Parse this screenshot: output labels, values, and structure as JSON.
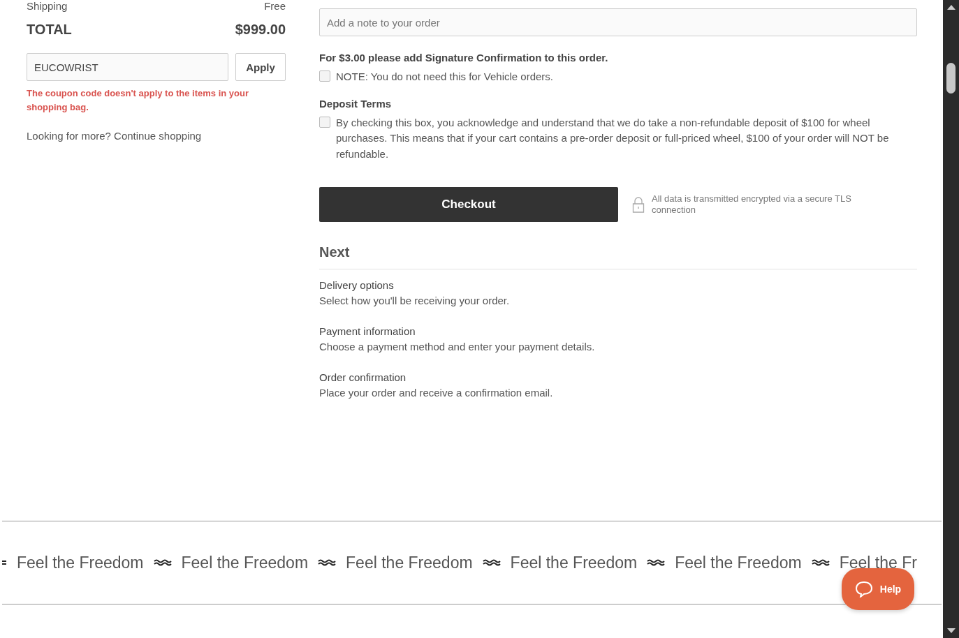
{
  "summary": {
    "shipping_label": "Shipping",
    "shipping_value": "Free",
    "total_label": "TOTAL",
    "total_value": "$999.00"
  },
  "coupon": {
    "value": "EUCOWRIST",
    "button": "Apply",
    "error": "The coupon code doesn't apply to the items in your shopping bag."
  },
  "continue": {
    "prefix": "Looking for more?",
    "link": "Continue shopping"
  },
  "order_note": {
    "placeholder": "Add a note to your order"
  },
  "signature": {
    "heading": "For $3.00 please add Signature Confirmation to this order.",
    "option": {
      "label": "NOTE: You do not need this for Vehicle orders.",
      "checked": false
    }
  },
  "deposit": {
    "heading": "Deposit Terms",
    "option": {
      "label": "By checking this box, you acknowledge and understand that we do take a non-refundable deposit of $100 for wheel purchases. This means that if your cart contains a pre-order deposit or full-priced wheel, $100 of your order will NOT be refundable.",
      "checked": false
    }
  },
  "checkout": {
    "button": "Checkout",
    "security_note": "All data is transmitted encrypted via a secure TLS connection"
  },
  "next": {
    "heading": "Next",
    "steps": [
      {
        "title": "Delivery options",
        "description": "Select how you'll be receiving your order."
      },
      {
        "title": "Payment information",
        "description": "Choose a payment method and enter your payment details."
      },
      {
        "title": "Order confirmation",
        "description": "Place your order and receive a confirmation email."
      }
    ]
  },
  "marquee": {
    "items": [
      "Feel the Freedom",
      "Feel the Freedom",
      "Feel the Freedom",
      "Feel the Freedom",
      "Feel the Freedom",
      "Feel the Fr"
    ]
  },
  "help_button": "Help"
}
